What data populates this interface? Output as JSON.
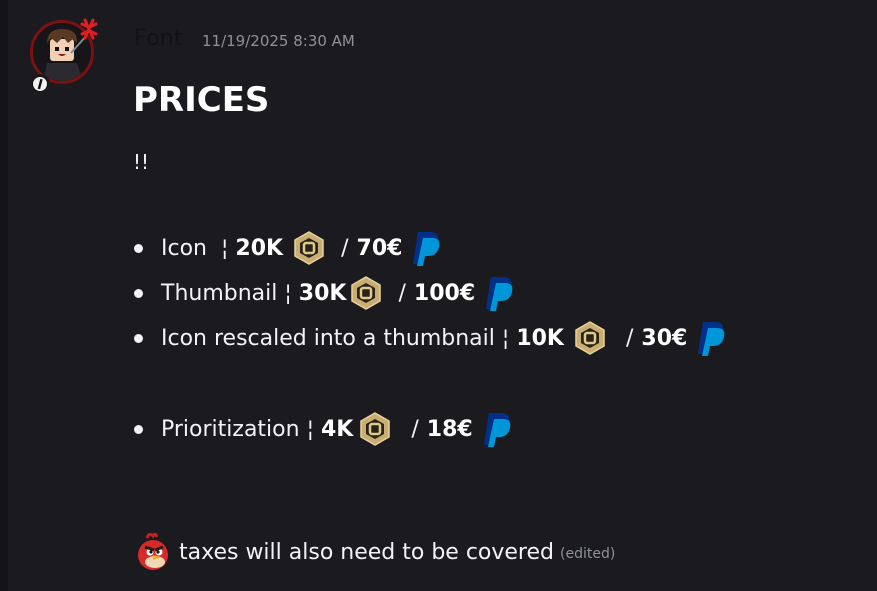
{
  "message": {
    "author": "Font",
    "timestamp": "11/19/2025 8:30 AM",
    "heading": "PRICES",
    "line1": "!!",
    "items": [
      {
        "label": "Icon",
        "sep": "¦",
        "robux": "20K",
        "slash": "/",
        "euro": "70€"
      },
      {
        "label": "Thumbnail",
        "sep": "¦",
        "robux": "30K",
        "slash": "/",
        "euro": "100€"
      },
      {
        "label": "Icon rescaled into a thumbnail",
        "sep": "¦",
        "robux": "10K",
        "slash": "/",
        "euro": "30€"
      },
      {
        "label": "Prioritization",
        "sep": "¦",
        "robux": "4K",
        "slash": "/",
        "euro": "18€"
      }
    ],
    "footer": "taxes will also need to be covered",
    "edited": "(edited)"
  },
  "icons": {
    "avatar": "avatar-image",
    "avatar_decoration": "angry-mark-icon",
    "robux": "robux-icon",
    "paypal": "paypal-icon",
    "bird": "angry-bird-emoji"
  },
  "colors": {
    "background": "#1b1b1f",
    "text": "#f2f3f5",
    "muted": "#8f9199",
    "robux_gold": "#c9ad72",
    "paypal_dark": "#003087",
    "paypal_light": "#009cde"
  }
}
